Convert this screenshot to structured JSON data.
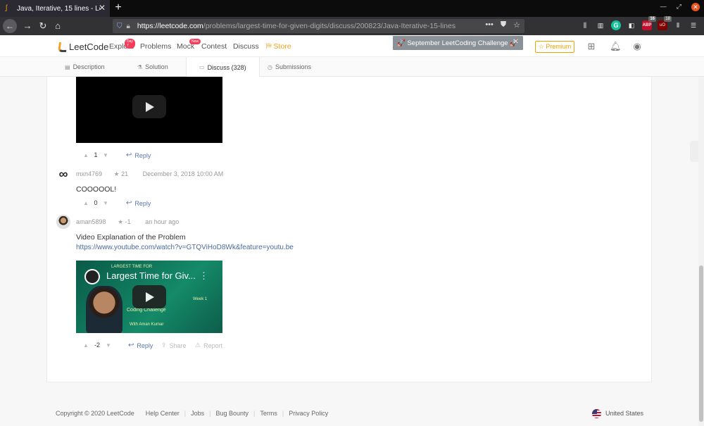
{
  "browser": {
    "tab_title": "Java, Iterative, 15 lines - Le",
    "tab_close": "✕",
    "new_tab": "+",
    "url_host": "https://leetcode.com",
    "url_path": "/problems/largest-time-for-given-digits/discuss/200823/Java-Iterative-15-lines",
    "url_dots": "•••",
    "extensions": {
      "grammarly": "G",
      "abp": "ABP",
      "abp_count": "16",
      "ublock": "uO",
      "ublock_count": "18"
    }
  },
  "header": {
    "logo_text": "LeetCode",
    "nav": [
      {
        "label": "Explore",
        "pill": "Day 7"
      },
      {
        "label": "Problems"
      },
      {
        "label": "Mock",
        "pill": "New"
      },
      {
        "label": "Contest"
      },
      {
        "label": "Discuss"
      },
      {
        "label": "Store"
      }
    ],
    "toast": "🚀 September LeetCoding Challenge 🚀",
    "toast_close": "✕",
    "premium": "☆ Premium"
  },
  "subtabs": {
    "description": "Description",
    "solution": "Solution",
    "discuss": "Discuss (328)",
    "submissions": "Submissions"
  },
  "comments": [
    {
      "votes": "1",
      "reply": "Reply"
    },
    {
      "user": "mxn4769",
      "reputation": "21",
      "time": "December 3, 2018 10:00 AM",
      "text": "COOOOOL!",
      "votes": "0",
      "reply": "Reply"
    },
    {
      "user": "aman5898",
      "reputation": "-1",
      "time": "an hour ago",
      "text": "Video Explanation of the Problem",
      "link": "https://www.youtube.com/watch?v=GTQViHoD8Wk&feature=youtu.be",
      "video_title": "Largest Time for Giv...",
      "video_small_top": "LARGEST TIME FOR",
      "video_small_coding": "Coding Challenge",
      "video_small_week": "Week 1",
      "video_small_by": "With Aman Kumar",
      "votes": "-2",
      "reply": "Reply",
      "share": "Share",
      "report": "Report"
    }
  ],
  "footer": {
    "copyright": "Copyright © 2020 LeetCode",
    "links": [
      "Help Center",
      "Jobs",
      "Bug Bounty",
      "Terms",
      "Privacy Policy"
    ],
    "country": "United States"
  }
}
